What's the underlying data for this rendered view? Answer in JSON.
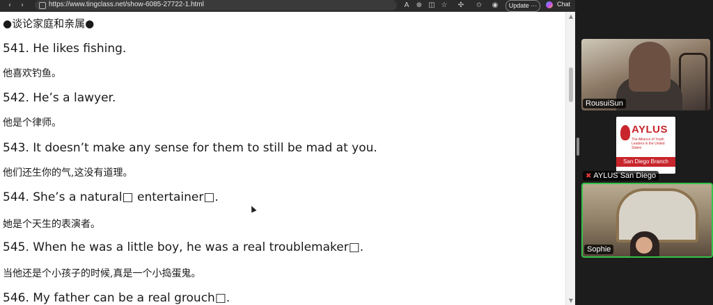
{
  "browser": {
    "url": "https://www.tingclass.net/show-6085-27722-1.html",
    "update_label": "Update",
    "chat_label": "Chat"
  },
  "content": {
    "heading": "●谈论家庭和亲属●",
    "lines": [
      {
        "en": "541. He likes fishing.",
        "zh": "他喜欢钓鱼。"
      },
      {
        "en": "542. He’s a lawyer.",
        "zh": "他是个律师。"
      },
      {
        "en": "543. It doesn’t make any sense for them to still be mad at you.",
        "zh": "他们还生你的气,这没有道理。"
      },
      {
        "en": "544. She’s a natural□ entertainer□.",
        "zh": "她是个天生的表演者。"
      },
      {
        "en": "545. When he was a little boy, he was a real troublemaker□.",
        "zh": "当他还是个小孩子的时候,真是一个小捣蛋鬼。"
      },
      {
        "en": "546. My father can be a real grouch□.",
        "zh": ""
      }
    ]
  },
  "meeting": {
    "participants": [
      {
        "name": "RousuiSun",
        "muted": false
      },
      {
        "name": "AYLUS San Diego",
        "muted": true
      },
      {
        "name": "Sophie",
        "muted": false,
        "active_speaker": true
      }
    ],
    "logo": {
      "title": "AYLUS",
      "subtitle": "The Alliance of Youth Leaders in the United States",
      "band": "San Diego Branch"
    }
  }
}
